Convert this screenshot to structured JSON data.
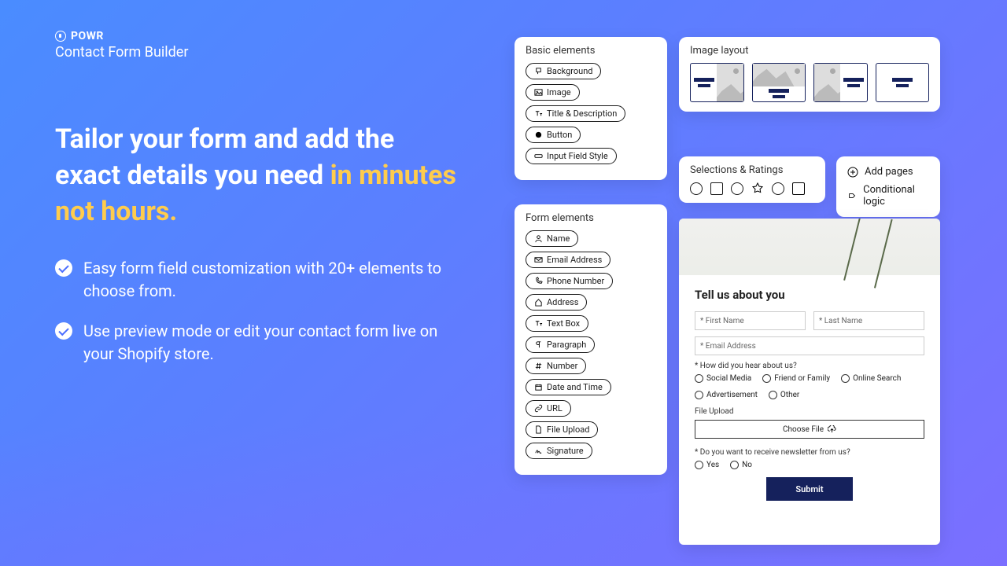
{
  "brand": {
    "name": "POWR",
    "product": "Contact Form Builder"
  },
  "headline": {
    "main": "Tailor your form and add the exact details you need ",
    "accent": "in minutes not hours."
  },
  "bullets": [
    "Easy form field customization with 20+ elements to choose from.",
    "Use preview mode or edit your contact form live on your Shopify store."
  ],
  "basic": {
    "title": "Basic elements",
    "items": [
      "Background",
      "Image",
      "Title & Description",
      "Button",
      "Input Field Style"
    ]
  },
  "imageLayout": {
    "title": "Image layout"
  },
  "selections": {
    "title": "Selections & Ratings"
  },
  "quick": {
    "addPages": "Add pages",
    "conditional": "Conditional logic"
  },
  "formEls": {
    "title": "Form elements",
    "items": [
      "Name",
      "Email Address",
      "Phone Number",
      "Address",
      "Text Box",
      "Paragraph",
      "Number",
      "Date and Time",
      "URL",
      "File Upload",
      "Signature"
    ]
  },
  "preview": {
    "title": "Tell us about you",
    "firstName": "* First Name",
    "lastName": "* Last Name",
    "email": "* Email Address",
    "hearLabel": "* How did you hear about us?",
    "hearOptions": [
      "Social Media",
      "Friend or Family",
      "Online Search",
      "Advertisement",
      "Other"
    ],
    "fileLabel": "File Upload",
    "chooseFile": "Choose File",
    "newsletterLabel": "* Do you want to receive newsletter from us?",
    "newsletterOptions": [
      "Yes",
      "No"
    ],
    "submit": "Submit"
  }
}
